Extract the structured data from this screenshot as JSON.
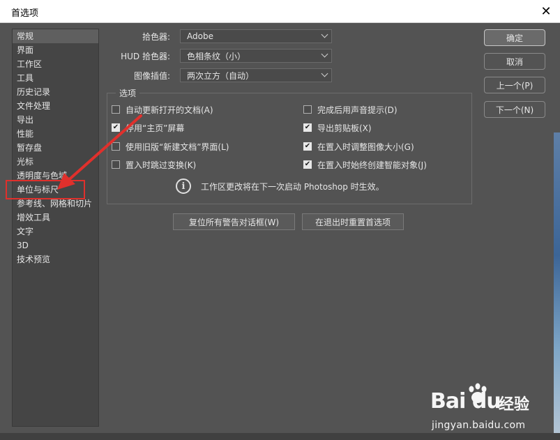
{
  "window": {
    "title": "首选项"
  },
  "sidebar": {
    "items": [
      {
        "label": "常规",
        "selected": true
      },
      {
        "label": "界面"
      },
      {
        "label": "工作区"
      },
      {
        "label": "工具"
      },
      {
        "label": "历史记录"
      },
      {
        "label": "文件处理"
      },
      {
        "label": "导出"
      },
      {
        "label": "性能"
      },
      {
        "label": "暂存盘"
      },
      {
        "label": "光标"
      },
      {
        "label": "透明度与色域"
      },
      {
        "label": "单位与标尺"
      },
      {
        "label": "参考线、网格和切片"
      },
      {
        "label": "增效工具"
      },
      {
        "label": "文字"
      },
      {
        "label": "3D"
      },
      {
        "label": "技术预览"
      }
    ]
  },
  "general": {
    "color_picker": {
      "label": "拾色器:",
      "value": "Adobe"
    },
    "hud_color_picker": {
      "label": "HUD 拾色器:",
      "value": "色相条纹（小）"
    },
    "image_interpolation": {
      "label": "图像插值:",
      "value": "两次立方（自动）"
    }
  },
  "options": {
    "legend": "选项",
    "left": [
      {
        "label": "自动更新打开的文档(A)",
        "checked": false
      },
      {
        "label": "停用“主页”屏幕",
        "checked": true
      },
      {
        "label": "使用旧版“新建文档”界面(L)",
        "checked": false
      },
      {
        "label": "置入时跳过变换(K)",
        "checked": false
      }
    ],
    "right": [
      {
        "label": "完成后用声音提示(D)",
        "checked": false
      },
      {
        "label": "导出剪贴板(X)",
        "checked": true
      },
      {
        "label": "在置入时调整图像大小(G)",
        "checked": true
      },
      {
        "label": "在置入时始终创建智能对象(J)",
        "checked": true
      }
    ],
    "info_text": "工作区更改将在下一次启动 Photoshop 时生效。"
  },
  "bottom_buttons": {
    "reset_warnings": "复位所有警告对话框(W)",
    "reset_prefs": "在退出时重置首选项"
  },
  "side_buttons": {
    "ok": "确定",
    "cancel": "取消",
    "prev": "上一个(P)",
    "next": "下一个(N)"
  },
  "watermark": {
    "brand": "Bai du",
    "cn": "经验",
    "url": "jingyan.baidu.com"
  },
  "colors": {
    "dialog_bg": "#535353",
    "sidebar_bg": "#454545",
    "annotation_red": "#e0302c"
  }
}
